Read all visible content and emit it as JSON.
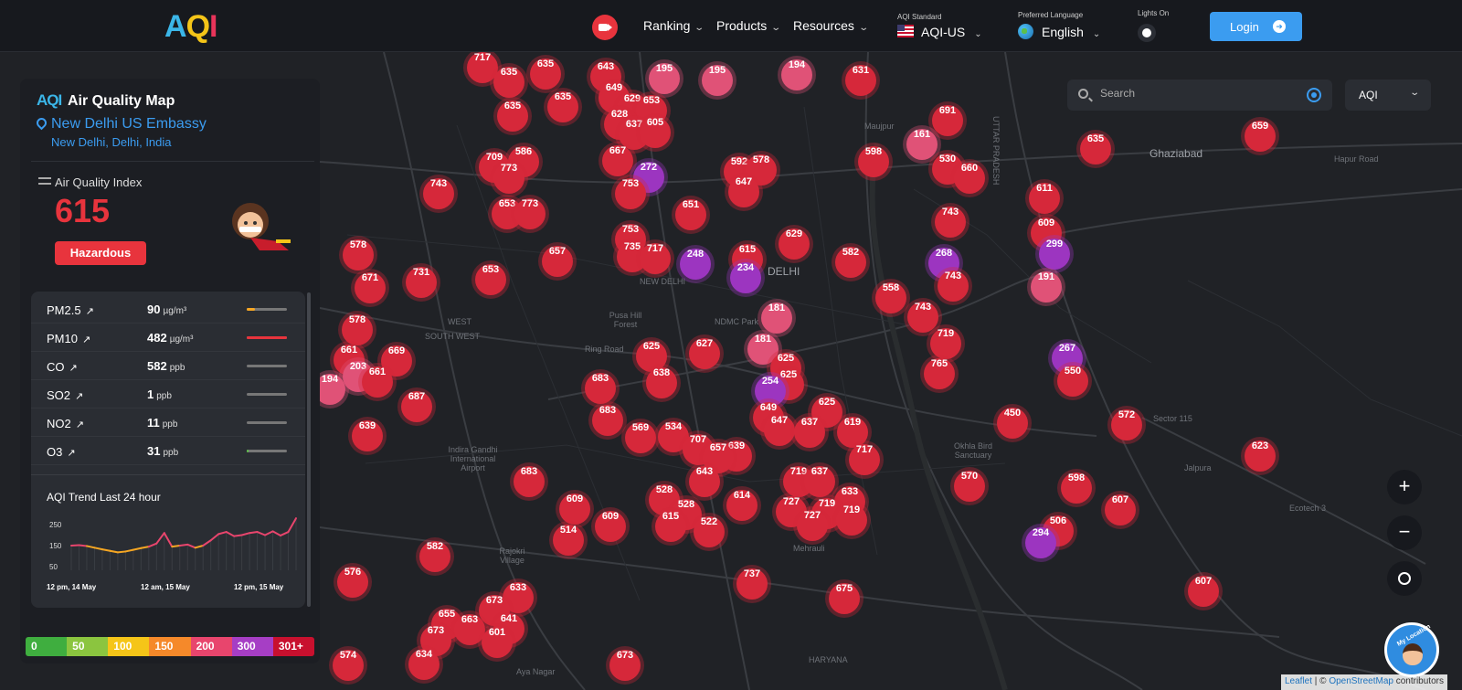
{
  "header": {
    "logo": {
      "a": "A",
      "q": "Q",
      "i": "I"
    },
    "nav": [
      {
        "label": "Ranking"
      },
      {
        "label": "Products"
      },
      {
        "label": "Resources"
      }
    ],
    "aqi_standard": {
      "label": "AQI Standard",
      "value": "AQI-US"
    },
    "language": {
      "label": "Preferred Language",
      "value": "English"
    },
    "lights": {
      "label": "Lights On"
    },
    "login_label": "Login"
  },
  "map": {
    "search_placeholder": "Search",
    "metric_value": "AQI",
    "zoom_in": "+",
    "zoom_out": "−",
    "my_location_label": "My Location",
    "attribution": {
      "leaflet": "Leaflet",
      "sep": " | © ",
      "osm": "OpenStreetMap",
      "tail": " contributors"
    },
    "place_labels": [
      {
        "text": "Ghaziabad",
        "big": true
      },
      {
        "text": "DELHI",
        "big": true
      },
      {
        "text": "NEW DELHI",
        "big": false
      },
      {
        "text": "NDMC Park",
        "big": false
      },
      {
        "text": "Ring Road",
        "big": false
      },
      {
        "text": "WEST",
        "big": false
      },
      {
        "text": "SOUTH WEST",
        "big": false
      },
      {
        "text": "Indira Gandhi International Airport",
        "big": false
      },
      {
        "text": "Mehrauli",
        "big": false
      },
      {
        "text": "Jalpura",
        "big": false
      },
      {
        "text": "Sector 115",
        "big": false
      },
      {
        "text": "Ecotech 3",
        "big": false
      },
      {
        "text": "UTTAR PRADESH",
        "big": false
      },
      {
        "text": "Hapur Road",
        "big": false
      },
      {
        "text": "Okhla Bird Sanctuary",
        "big": false
      },
      {
        "text": "Aya Nagar",
        "big": false
      },
      {
        "text": "HARYANA",
        "big": false
      },
      {
        "text": "Maujpur",
        "big": false
      },
      {
        "text": "Pusa Hill Forest",
        "big": false
      },
      {
        "text": "Rajokri Village",
        "big": false
      }
    ],
    "markers": [
      {
        "v": "717",
        "x": 528,
        "y": 17,
        "c": "red"
      },
      {
        "v": "635",
        "x": 597,
        "y": 24,
        "c": "red"
      },
      {
        "v": "643",
        "x": 663,
        "y": 27,
        "c": "red"
      },
      {
        "v": "195",
        "x": 727,
        "y": 29,
        "c": "pink"
      },
      {
        "v": "195",
        "x": 785,
        "y": 31,
        "c": "pink"
      },
      {
        "v": "194",
        "x": 872,
        "y": 25,
        "c": "pink"
      },
      {
        "v": "631",
        "x": 942,
        "y": 31,
        "c": "red"
      },
      {
        "v": "635",
        "x": 557,
        "y": 33,
        "c": "red"
      },
      {
        "v": "649",
        "x": 672,
        "y": 50,
        "c": "red"
      },
      {
        "v": "629",
        "x": 692,
        "y": 62,
        "c": "red"
      },
      {
        "v": "653",
        "x": 713,
        "y": 64,
        "c": "red"
      },
      {
        "v": "635",
        "x": 561,
        "y": 70,
        "c": "red"
      },
      {
        "v": "635",
        "x": 616,
        "y": 60,
        "c": "red"
      },
      {
        "v": "628",
        "x": 678,
        "y": 79,
        "c": "red"
      },
      {
        "v": "637",
        "x": 694,
        "y": 90,
        "c": "red"
      },
      {
        "v": "605",
        "x": 717,
        "y": 88,
        "c": "red"
      },
      {
        "v": "691",
        "x": 1037,
        "y": 75,
        "c": "red"
      },
      {
        "v": "161",
        "x": 1009,
        "y": 101,
        "c": "pink"
      },
      {
        "v": "635",
        "x": 1199,
        "y": 106,
        "c": "red"
      },
      {
        "v": "659",
        "x": 1379,
        "y": 92,
        "c": "red"
      },
      {
        "v": "709",
        "x": 541,
        "y": 126,
        "c": "red"
      },
      {
        "v": "586",
        "x": 573,
        "y": 120,
        "c": "red"
      },
      {
        "v": "773",
        "x": 557,
        "y": 138,
        "c": "red"
      },
      {
        "v": "667",
        "x": 676,
        "y": 119,
        "c": "red"
      },
      {
        "v": "272",
        "x": 710,
        "y": 137,
        "c": "purple"
      },
      {
        "v": "592",
        "x": 809,
        "y": 131,
        "c": "red"
      },
      {
        "v": "578",
        "x": 833,
        "y": 129,
        "c": "red"
      },
      {
        "v": "598",
        "x": 956,
        "y": 120,
        "c": "red"
      },
      {
        "v": "530",
        "x": 1037,
        "y": 128,
        "c": "red"
      },
      {
        "v": "660",
        "x": 1061,
        "y": 138,
        "c": "red"
      },
      {
        "v": "743",
        "x": 480,
        "y": 155,
        "c": "red"
      },
      {
        "v": "753",
        "x": 690,
        "y": 155,
        "c": "red"
      },
      {
        "v": "647",
        "x": 814,
        "y": 153,
        "c": "red"
      },
      {
        "v": "611",
        "x": 1143,
        "y": 160,
        "c": "red"
      },
      {
        "v": "653",
        "x": 555,
        "y": 177,
        "c": "red"
      },
      {
        "v": "773",
        "x": 580,
        "y": 177,
        "c": "red"
      },
      {
        "v": "651",
        "x": 756,
        "y": 178,
        "c": "red"
      },
      {
        "v": "743",
        "x": 1040,
        "y": 186,
        "c": "red"
      },
      {
        "v": "609",
        "x": 1145,
        "y": 198,
        "c": "red"
      },
      {
        "v": "299",
        "x": 1154,
        "y": 221,
        "c": "purple"
      },
      {
        "v": "578",
        "x": 392,
        "y": 222,
        "c": "red"
      },
      {
        "v": "753",
        "x": 690,
        "y": 205,
        "c": "red"
      },
      {
        "v": "629",
        "x": 869,
        "y": 210,
        "c": "red"
      },
      {
        "v": "657",
        "x": 610,
        "y": 229,
        "c": "red"
      },
      {
        "v": "735",
        "x": 692,
        "y": 224,
        "c": "red"
      },
      {
        "v": "717",
        "x": 717,
        "y": 226,
        "c": "red"
      },
      {
        "v": "248",
        "x": 761,
        "y": 232,
        "c": "purple"
      },
      {
        "v": "615",
        "x": 818,
        "y": 227,
        "c": "red"
      },
      {
        "v": "582",
        "x": 931,
        "y": 230,
        "c": "red"
      },
      {
        "v": "268",
        "x": 1033,
        "y": 231,
        "c": "purple"
      },
      {
        "v": "671",
        "x": 405,
        "y": 258,
        "c": "red"
      },
      {
        "v": "731",
        "x": 461,
        "y": 252,
        "c": "red"
      },
      {
        "v": "653",
        "x": 537,
        "y": 249,
        "c": "red"
      },
      {
        "v": "234",
        "x": 816,
        "y": 247,
        "c": "purple"
      },
      {
        "v": "743",
        "x": 1043,
        "y": 256,
        "c": "red"
      },
      {
        "v": "191",
        "x": 1145,
        "y": 257,
        "c": "pink"
      },
      {
        "v": "558",
        "x": 975,
        "y": 269,
        "c": "red"
      },
      {
        "v": "181",
        "x": 850,
        "y": 291,
        "c": "pink"
      },
      {
        "v": "743",
        "x": 1010,
        "y": 290,
        "c": "red"
      },
      {
        "v": "578",
        "x": 391,
        "y": 304,
        "c": "red"
      },
      {
        "v": "181",
        "x": 835,
        "y": 325,
        "c": "pink"
      },
      {
        "v": "719",
        "x": 1035,
        "y": 319,
        "c": "red"
      },
      {
        "v": "661",
        "x": 382,
        "y": 337,
        "c": "red"
      },
      {
        "v": "669",
        "x": 434,
        "y": 338,
        "c": "red"
      },
      {
        "v": "625",
        "x": 713,
        "y": 333,
        "c": "red"
      },
      {
        "v": "627",
        "x": 771,
        "y": 330,
        "c": "red"
      },
      {
        "v": "625",
        "x": 860,
        "y": 346,
        "c": "red"
      },
      {
        "v": "267",
        "x": 1168,
        "y": 335,
        "c": "purple"
      },
      {
        "v": "203",
        "x": 392,
        "y": 355,
        "c": "pink"
      },
      {
        "v": "661",
        "x": 413,
        "y": 361,
        "c": "red"
      },
      {
        "v": "765",
        "x": 1028,
        "y": 352,
        "c": "red"
      },
      {
        "v": "550",
        "x": 1174,
        "y": 360,
        "c": "red"
      },
      {
        "v": "194",
        "x": 361,
        "y": 369,
        "c": "pink"
      },
      {
        "v": "638",
        "x": 724,
        "y": 362,
        "c": "red"
      },
      {
        "v": "625",
        "x": 863,
        "y": 364,
        "c": "red"
      },
      {
        "v": "683",
        "x": 657,
        "y": 368,
        "c": "red"
      },
      {
        "v": "254",
        "x": 843,
        "y": 371,
        "c": "purple"
      },
      {
        "v": "687",
        "x": 456,
        "y": 388,
        "c": "red"
      },
      {
        "v": "625",
        "x": 905,
        "y": 394,
        "c": "red"
      },
      {
        "v": "649",
        "x": 841,
        "y": 400,
        "c": "red"
      },
      {
        "v": "683",
        "x": 665,
        "y": 403,
        "c": "red"
      },
      {
        "v": "647",
        "x": 853,
        "y": 414,
        "c": "red"
      },
      {
        "v": "637",
        "x": 886,
        "y": 416,
        "c": "red"
      },
      {
        "v": "619",
        "x": 933,
        "y": 416,
        "c": "red"
      },
      {
        "v": "450",
        "x": 1108,
        "y": 406,
        "c": "red"
      },
      {
        "v": "572",
        "x": 1233,
        "y": 408,
        "c": "red"
      },
      {
        "v": "639",
        "x": 402,
        "y": 420,
        "c": "red"
      },
      {
        "v": "569",
        "x": 701,
        "y": 422,
        "c": "red"
      },
      {
        "v": "534",
        "x": 737,
        "y": 421,
        "c": "red"
      },
      {
        "v": "707",
        "x": 764,
        "y": 435,
        "c": "red"
      },
      {
        "v": "639",
        "x": 806,
        "y": 442,
        "c": "red"
      },
      {
        "v": "657",
        "x": 786,
        "y": 444,
        "c": "red"
      },
      {
        "v": "717",
        "x": 946,
        "y": 446,
        "c": "red"
      },
      {
        "v": "623",
        "x": 1379,
        "y": 442,
        "c": "red"
      },
      {
        "v": "683",
        "x": 579,
        "y": 470,
        "c": "red"
      },
      {
        "v": "643",
        "x": 771,
        "y": 470,
        "c": "red"
      },
      {
        "v": "719",
        "x": 874,
        "y": 470,
        "c": "red"
      },
      {
        "v": "637",
        "x": 897,
        "y": 470,
        "c": "red"
      },
      {
        "v": "570",
        "x": 1061,
        "y": 475,
        "c": "red"
      },
      {
        "v": "598",
        "x": 1178,
        "y": 477,
        "c": "red"
      },
      {
        "v": "528",
        "x": 727,
        "y": 490,
        "c": "red"
      },
      {
        "v": "633",
        "x": 930,
        "y": 492,
        "c": "red"
      },
      {
        "v": "609",
        "x": 629,
        "y": 500,
        "c": "red"
      },
      {
        "v": "614",
        "x": 812,
        "y": 496,
        "c": "red"
      },
      {
        "v": "727",
        "x": 866,
        "y": 503,
        "c": "red"
      },
      {
        "v": "719",
        "x": 905,
        "y": 505,
        "c": "red"
      },
      {
        "v": "528",
        "x": 751,
        "y": 506,
        "c": "red"
      },
      {
        "v": "607",
        "x": 1226,
        "y": 501,
        "c": "red"
      },
      {
        "v": "719",
        "x": 932,
        "y": 512,
        "c": "red"
      },
      {
        "v": "727",
        "x": 889,
        "y": 518,
        "c": "red"
      },
      {
        "v": "609",
        "x": 668,
        "y": 519,
        "c": "red"
      },
      {
        "v": "615",
        "x": 734,
        "y": 519,
        "c": "red"
      },
      {
        "v": "522",
        "x": 776,
        "y": 525,
        "c": "red"
      },
      {
        "v": "506",
        "x": 1158,
        "y": 524,
        "c": "red"
      },
      {
        "v": "294",
        "x": 1139,
        "y": 537,
        "c": "purple"
      },
      {
        "v": "514",
        "x": 622,
        "y": 534,
        "c": "red"
      },
      {
        "v": "582",
        "x": 476,
        "y": 552,
        "c": "red"
      },
      {
        "v": "576",
        "x": 386,
        "y": 580,
        "c": "red"
      },
      {
        "v": "737",
        "x": 823,
        "y": 582,
        "c": "red"
      },
      {
        "v": "607",
        "x": 1317,
        "y": 590,
        "c": "red"
      },
      {
        "v": "675",
        "x": 924,
        "y": 598,
        "c": "red"
      },
      {
        "v": "633",
        "x": 567,
        "y": 597,
        "c": "red"
      },
      {
        "v": "673",
        "x": 541,
        "y": 611,
        "c": "red"
      },
      {
        "v": "655",
        "x": 489,
        "y": 626,
        "c": "red"
      },
      {
        "v": "663",
        "x": 514,
        "y": 632,
        "c": "red"
      },
      {
        "v": "641",
        "x": 557,
        "y": 631,
        "c": "red"
      },
      {
        "v": "673",
        "x": 477,
        "y": 644,
        "c": "red"
      },
      {
        "v": "601",
        "x": 544,
        "y": 646,
        "c": "red"
      },
      {
        "v": "574",
        "x": 381,
        "y": 671,
        "c": "red"
      },
      {
        "v": "634",
        "x": 464,
        "y": 670,
        "c": "red"
      },
      {
        "v": "673",
        "x": 684,
        "y": 671,
        "c": "red"
      }
    ]
  },
  "panel": {
    "logo": "AQI",
    "title": "Air Quality Map",
    "station_name": "New Delhi US Embassy",
    "station_location": "New Delhi, Delhi, India",
    "aqi_label": "Air Quality Index",
    "aqi_value": "615",
    "aqi_category": "Hazardous",
    "pollutants": [
      {
        "name": "PM2.5",
        "value": "90",
        "unit": "µg/m³",
        "fill": 0.2,
        "color": "#f5a623"
      },
      {
        "name": "PM10",
        "value": "482",
        "unit": "µg/m³",
        "fill": 1.0,
        "color": "#e8343d"
      },
      {
        "name": "CO",
        "value": "582",
        "unit": "ppb",
        "fill": 0,
        "color": "#777777"
      },
      {
        "name": "SO2",
        "value": "1",
        "unit": "ppb",
        "fill": 0,
        "color": "#777777"
      },
      {
        "name": "NO2",
        "value": "11",
        "unit": "ppb",
        "fill": 0,
        "color": "#777777"
      },
      {
        "name": "O3",
        "value": "31",
        "unit": "ppb",
        "fill": 0.05,
        "color": "#5cbf4a"
      }
    ],
    "trend": {
      "title": "AQI Trend Last 24 hour",
      "y_ticks": [
        "250",
        "150",
        "50"
      ],
      "x_labels": [
        "12 pm, 14 May",
        "12 am, 15 May",
        "12 pm, 15 May"
      ],
      "values": [
        150,
        152,
        148,
        140,
        132,
        125,
        118,
        122,
        130,
        138,
        145,
        160,
        210,
        145,
        150,
        155,
        140,
        150,
        175,
        205,
        215,
        195,
        200,
        210,
        215,
        200,
        218,
        198,
        215,
        280
      ]
    }
  },
  "legend": [
    {
      "label": "0",
      "color": "#3fae3f"
    },
    {
      "label": "50",
      "color": "#8bc53f"
    },
    {
      "label": "100",
      "color": "#f5c518"
    },
    {
      "label": "150",
      "color": "#f5892a"
    },
    {
      "label": "200",
      "color": "#e8456d"
    },
    {
      "label": "300",
      "color": "#a63ec5"
    },
    {
      "label": "301+",
      "color": "#c8102e"
    }
  ],
  "colors": {
    "red": "#d6283a",
    "pink": "#e05277",
    "purple": "#9c35c0"
  }
}
